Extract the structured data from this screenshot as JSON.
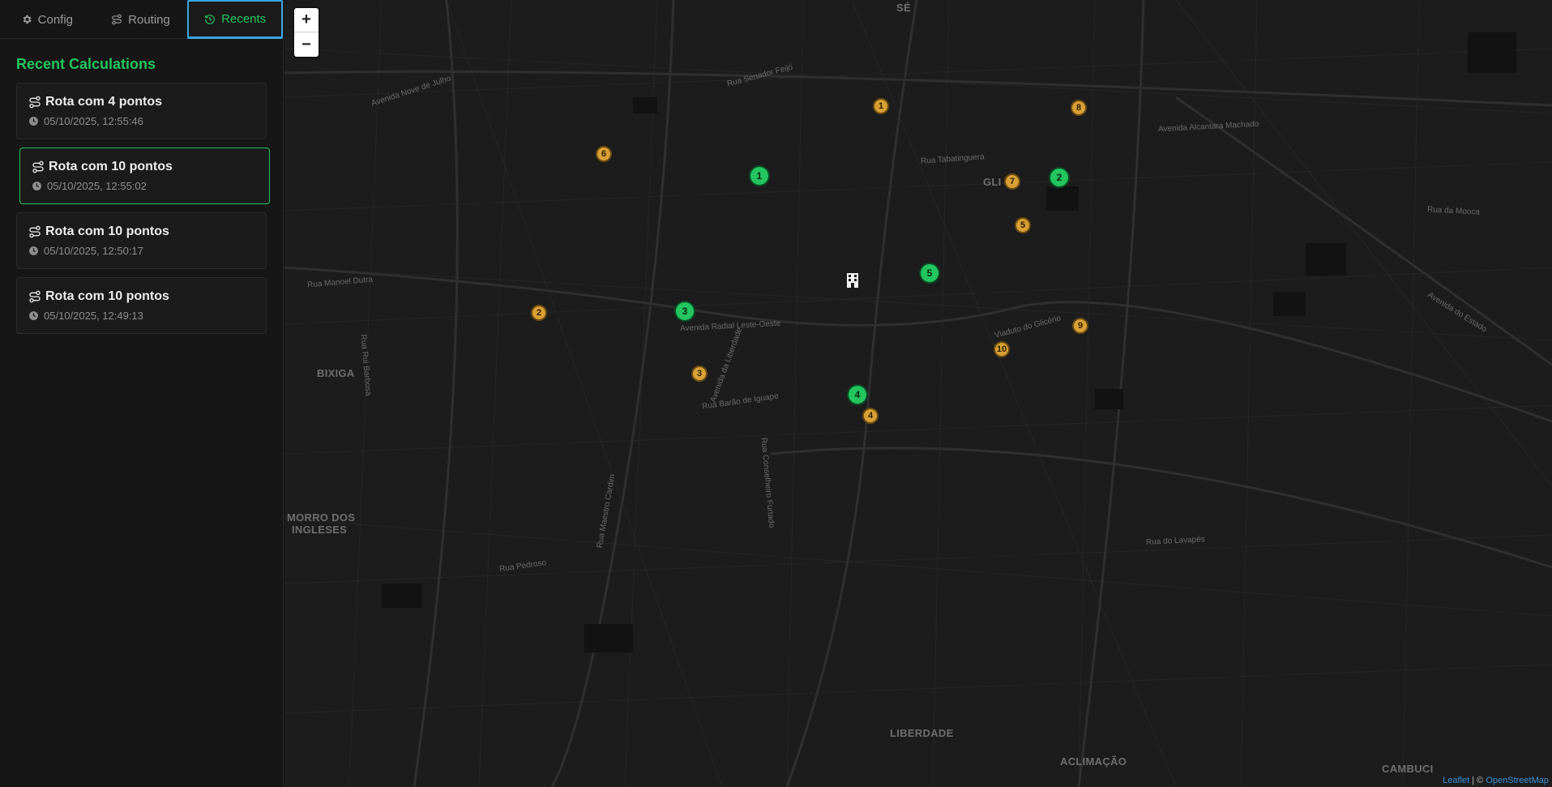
{
  "tabs": [
    {
      "label": "Config",
      "icon": "gear-icon"
    },
    {
      "label": "Routing",
      "icon": "route-icon"
    },
    {
      "label": "Recents",
      "icon": "history-icon"
    }
  ],
  "recents": {
    "title": "Recent Calculations",
    "items": [
      {
        "title": "Rota com 4 pontos",
        "time": "05/10/2025, 12:55:46"
      },
      {
        "title": "Rota com 10 pontos",
        "time": "05/10/2025, 12:55:02"
      },
      {
        "title": "Rota com 10 pontos",
        "time": "05/10/2025, 12:50:17"
      },
      {
        "title": "Rota com 10 pontos",
        "time": "05/10/2025, 12:49:13"
      }
    ]
  },
  "map": {
    "zoom_in": "+",
    "zoom_out": "−",
    "places": [
      "SÉ",
      "BIXIGA",
      "MORRO DOS",
      "INGLESES",
      "LIBERDADE",
      "ACLIMAÇÃO",
      "CAMBUCI",
      "GLI"
    ],
    "streets": [
      "Avenida Nove de Julho",
      "Rua Senador Feijó",
      "Rua Tabatinguera",
      "Rua da Mooca",
      "Avenida Alcantara Machado",
      "Avenida Radial Leste-Oeste",
      "Viaduto do Glicério",
      "Avenida do Estado",
      "Rua do Lavapés",
      "Rua Pedroso",
      "Avenida da Liberdade",
      "Rua Barão de Iguape",
      "Rua Conselheiro Furtado",
      "Rua Maestro Cardim",
      "Rua Rui Barbosa",
      "Rua Manoel Dutra"
    ],
    "attribution": {
      "leaflet": "Leaflet",
      "separator": "| ©",
      "osm": "OpenStreetMap"
    },
    "orange_stops": [
      "1",
      "2",
      "3",
      "4",
      "5",
      "6",
      "7",
      "8",
      "9",
      "10"
    ],
    "green_stops": [
      "1",
      "2",
      "3",
      "4",
      "5"
    ],
    "depot_icon": "building-icon",
    "colors": {
      "accent": "#22c55e",
      "orange": "#d9a035",
      "tab_focus": "#3aa6e0"
    }
  }
}
